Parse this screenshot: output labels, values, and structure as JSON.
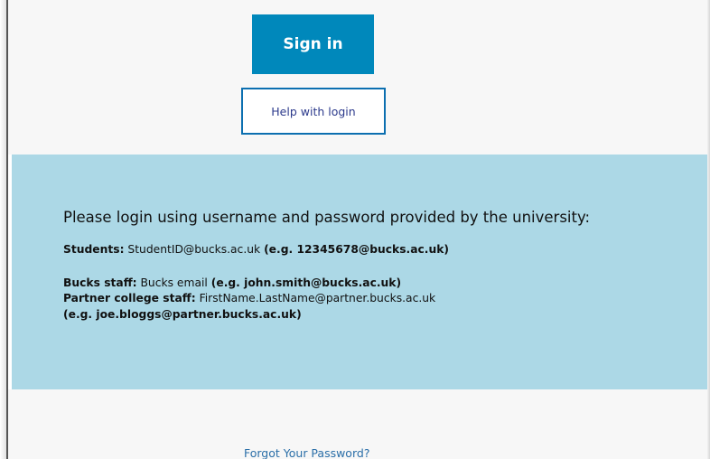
{
  "colors": {
    "primary_button": "#0088bb",
    "help_border": "#0c6fb0",
    "info_panel_bg": "#acd8e6",
    "page_bg": "#f7f7f7",
    "link": "#2b6fa8"
  },
  "login": {
    "sign_in_label": "Sign in",
    "help_label": "Help with login"
  },
  "info": {
    "title": "Please login using username and password provided by the university:",
    "students": {
      "label": "Students:",
      "format": " StudentID@bucks.ac.uk ",
      "example": "(e.g. 12345678@bucks.ac.uk)"
    },
    "bucks_staff": {
      "label": "Bucks staff:",
      "format": " Bucks email ",
      "example": "(e.g. john.smith@bucks.ac.uk)"
    },
    "partner_staff": {
      "label": "Partner college staff:",
      "format": " FirstName.LastName@partner.bucks.ac.uk",
      "example": "(e.g. joe.bloggs@partner.bucks.ac.uk)"
    }
  },
  "footer": {
    "forgot_password": "Forgot Your Password?"
  }
}
